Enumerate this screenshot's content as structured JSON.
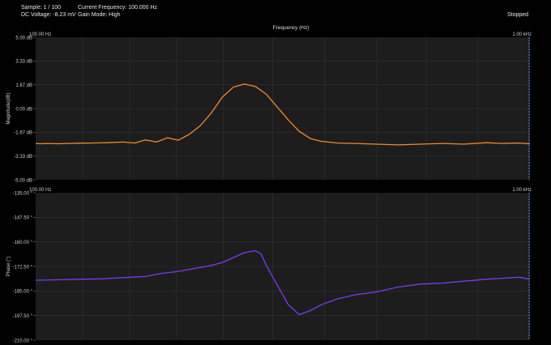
{
  "status": {
    "sample": "Sample: 1 / 100",
    "dc_voltage": "DC Voltage: -8.23 mV",
    "current_frequency": "Current Frequency: 100.000 Hz",
    "gain_mode": "Gain Mode: High",
    "state": "Stopped"
  },
  "colors": {
    "background": "#000000",
    "plot_bg": "#1d1d1d",
    "grid": "#333333",
    "magnitude": "#f08a2c",
    "phase": "#7a3cf0",
    "marker": "#5a78d8"
  },
  "chart_data": [
    {
      "type": "line",
      "title": "Frequency (Hz)",
      "ylabel": "Magnitude(dB)",
      "x_left_label": "100.00 Hz",
      "x_right_label": "1.00 kHz",
      "y_ticks": [
        "5.00 dB",
        "3.33 dB",
        "1.67 dB",
        "0.00 dB",
        "-1.67 dB",
        "-3.33 dB",
        "-5.00 dB"
      ],
      "ylim": [
        -5.0,
        5.0
      ],
      "xlim": [
        100,
        1000
      ],
      "series": [
        {
          "values": [
            [
              100,
              -2.45
            ],
            [
              110,
              -2.47
            ],
            [
              120,
              -2.45
            ],
            [
              140,
              -2.47
            ],
            [
              160,
              -2.45
            ],
            [
              180,
              -2.43
            ],
            [
              200,
              -2.42
            ],
            [
              230,
              -2.4
            ],
            [
              260,
              -2.35
            ],
            [
              280,
              -2.42
            ],
            [
              300,
              -2.2
            ],
            [
              320,
              -2.35
            ],
            [
              340,
              -2.05
            ],
            [
              360,
              -2.22
            ],
            [
              380,
              -1.8
            ],
            [
              400,
              -1.2
            ],
            [
              420,
              -0.3
            ],
            [
              440,
              0.8
            ],
            [
              460,
              1.5
            ],
            [
              480,
              1.72
            ],
            [
              500,
              1.55
            ],
            [
              520,
              1.0
            ],
            [
              540,
              0.1
            ],
            [
              560,
              -0.8
            ],
            [
              580,
              -1.6
            ],
            [
              600,
              -2.1
            ],
            [
              620,
              -2.3
            ],
            [
              650,
              -2.42
            ],
            [
              680,
              -2.45
            ],
            [
              720,
              -2.5
            ],
            [
              760,
              -2.55
            ],
            [
              800,
              -2.5
            ],
            [
              840,
              -2.45
            ],
            [
              880,
              -2.5
            ],
            [
              920,
              -2.4
            ],
            [
              950,
              -2.45
            ],
            [
              980,
              -2.42
            ],
            [
              1000,
              -2.48
            ]
          ]
        }
      ]
    },
    {
      "type": "line",
      "ylabel": "Phase (°)",
      "x_left_label": "100.00 Hz",
      "x_right_label": "1.00 kHz",
      "y_ticks": [
        "-135.00 °",
        "-147.50 °",
        "-160.00 °",
        "-172.50 °",
        "-185.00 °",
        "-197.50 °",
        "-210.00 °"
      ],
      "ylim": [
        -210.0,
        -135.0
      ],
      "xlim": [
        100,
        1000
      ],
      "series": [
        {
          "values": [
            [
              100,
              -179.5
            ],
            [
              140,
              -179.3
            ],
            [
              180,
              -179.0
            ],
            [
              220,
              -178.8
            ],
            [
              260,
              -178.2
            ],
            [
              300,
              -177.6
            ],
            [
              330,
              -176.0
            ],
            [
              360,
              -175.0
            ],
            [
              390,
              -173.5
            ],
            [
              420,
              -172.0
            ],
            [
              440,
              -170.5
            ],
            [
              460,
              -168.0
            ],
            [
              480,
              -165.5
            ],
            [
              500,
              -164.5
            ],
            [
              510,
              -166.0
            ],
            [
              520,
              -172.0
            ],
            [
              540,
              -182.0
            ],
            [
              560,
              -192.0
            ],
            [
              580,
              -197.0
            ],
            [
              600,
              -195.0
            ],
            [
              620,
              -192.0
            ],
            [
              650,
              -189.0
            ],
            [
              680,
              -187.0
            ],
            [
              720,
              -185.5
            ],
            [
              760,
              -183.0
            ],
            [
              800,
              -181.5
            ],
            [
              840,
              -181.0
            ],
            [
              880,
              -180.0
            ],
            [
              920,
              -179.0
            ],
            [
              950,
              -178.5
            ],
            [
              980,
              -178.0
            ],
            [
              1000,
              -179.0
            ]
          ]
        }
      ]
    }
  ]
}
